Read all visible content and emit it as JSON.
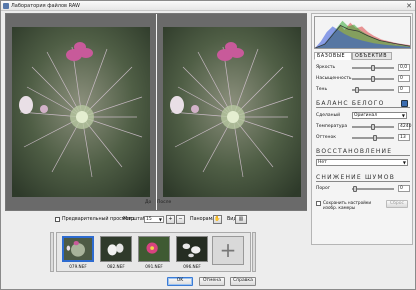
{
  "window": {
    "title": "Лаборатория файлов RAW",
    "close_glyph": "✕"
  },
  "preview": {
    "before_label": "До",
    "after_label": "После"
  },
  "panel": {
    "tabs": [
      "БАЗОВЫЕ",
      "ОБЪЕКТИВ"
    ],
    "basic": [
      {
        "label": "Яркость",
        "value": "0,0",
        "level": 0.5
      },
      {
        "label": "Насыщенность",
        "value": "0",
        "level": 0.5
      },
      {
        "label": "Тень",
        "value": "0",
        "level": 0.06
      }
    ],
    "white_balance": {
      "title": "БАЛАНС БЕЛОГО",
      "preset_label": "Сделаный",
      "preset_value": "Оригинал",
      "temperature_label": "Температура",
      "temperature_value": "4240",
      "temperature_level": 0.5,
      "tint_label": "Оттенок",
      "tint_value": "13",
      "tint_level": 0.55
    },
    "restore": {
      "title": "ВОССТАНОВЛЕНИЕ",
      "value": "Нет"
    },
    "noise": {
      "title": "СНИЖЕНИЕ ШУМОВ",
      "threshold_label": "Порог",
      "threshold_value": "0",
      "threshold_level": 0.0
    },
    "save_label": "Сохранить настройки изобр. камеры",
    "reset_label": "Сброс"
  },
  "toolbar": {
    "preview_label": "Предварительный просмотр",
    "scale_label": "Масштаб",
    "scale_value": "15",
    "panorama_label": "Панорама",
    "view_label": "Вид"
  },
  "thumbnails": [
    {
      "name": "079.NEF",
      "selected": true
    },
    {
      "name": "082.NEF",
      "selected": false
    },
    {
      "name": "091.NEF",
      "selected": false
    },
    {
      "name": "096.NEF",
      "selected": false
    }
  ],
  "buttons": {
    "ok": "OK",
    "cancel": "Отмена",
    "help": "Справка"
  },
  "icons": {
    "window": "raw-lab-icon",
    "eyedropper": "eyedropper-icon",
    "add": "plus-icon",
    "zoom_in": "zoom-in-icon",
    "zoom_out": "zoom-out-icon",
    "pan": "hand-icon",
    "view": "split-view-icon"
  },
  "colors": {
    "accent": "#2d6bd0",
    "primary_button_border": "#3a7bd5"
  }
}
